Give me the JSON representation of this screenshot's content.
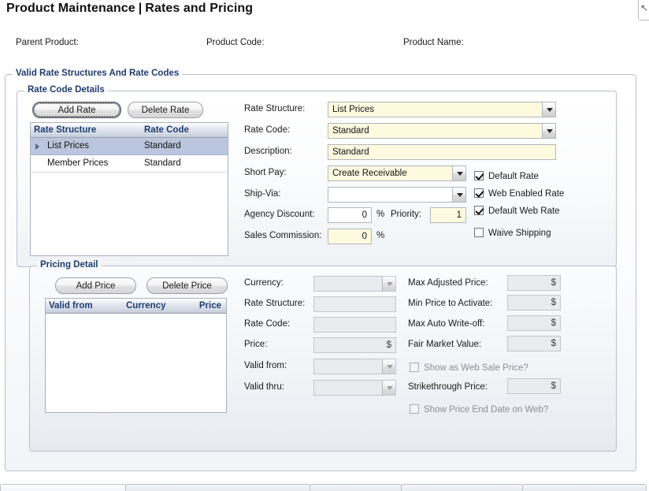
{
  "page": {
    "title_main": "Product Maintenance",
    "title_sep": "|",
    "title_sub": "Rates and Pricing"
  },
  "header_fields": [
    {
      "label": "Parent Product:",
      "value": ""
    },
    {
      "label": "Product Code:",
      "value": ""
    },
    {
      "label": "Product Name:",
      "value": ""
    }
  ],
  "outer_group": {
    "title": "Valid Rate Structures And Rate Codes"
  },
  "rate_code_details": {
    "title": "Rate Code Details",
    "buttons": {
      "add": "Add Rate",
      "delete": "Delete Rate"
    },
    "grid": {
      "columns": [
        "Rate Structure",
        "Rate Code"
      ],
      "rows": [
        {
          "rate_structure": "List Prices",
          "rate_code": "Standard",
          "selected": true
        },
        {
          "rate_structure": "Member Prices",
          "rate_code": "Standard",
          "selected": false
        }
      ]
    },
    "fields": {
      "rate_structure_label": "Rate Structure:",
      "rate_structure_value": "List Prices",
      "rate_code_label": "Rate Code:",
      "rate_code_value": "Standard",
      "description_label": "Description:",
      "description_value": "Standard",
      "short_pay_label": "Short Pay:",
      "short_pay_value": "Create Receivable",
      "ship_via_label": "Ship-Via:",
      "ship_via_value": "",
      "agency_discount_label": "Agency Discount:",
      "agency_discount_value": "0",
      "agency_discount_suffix": "%",
      "priority_label": "Priority:",
      "priority_value": "1",
      "sales_commission_label": "Sales Commission:",
      "sales_commission_value": "0",
      "sales_commission_suffix": "%"
    },
    "checkboxes": [
      {
        "label": "Default Rate",
        "checked": true,
        "enabled": true
      },
      {
        "label": "Web Enabled Rate",
        "checked": true,
        "enabled": true
      },
      {
        "label": "Default Web Rate",
        "checked": true,
        "enabled": true
      },
      {
        "label": "Waive Shipping",
        "checked": false,
        "enabled": true
      }
    ]
  },
  "pricing_detail": {
    "title": "Pricing Detail",
    "buttons": {
      "add": "Add Price",
      "delete": "Delete Price"
    },
    "grid": {
      "columns": [
        "Valid from",
        "Currency",
        "Price"
      ],
      "rows": []
    },
    "fields_left": {
      "currency_label": "Currency:",
      "currency_value": "",
      "rate_structure_label": "Rate Structure:",
      "rate_structure_value": "",
      "rate_code_label": "Rate Code:",
      "rate_code_value": "",
      "price_label": "Price:",
      "price_value": "",
      "price_suffix": "$",
      "valid_from_label": "Valid from:",
      "valid_from_value": "",
      "valid_thru_label": "Valid thru:",
      "valid_thru_value": ""
    },
    "fields_right": {
      "max_adjusted_price_label": "Max Adjusted Price:",
      "max_adjusted_price_value": "",
      "min_price_to_activate_label": "Min Price to Activate:",
      "min_price_to_activate_value": "",
      "max_auto_writeoff_label": "Max Auto Write-off:",
      "max_auto_writeoff_value": "",
      "fair_market_value_label": "Fair Market Value:",
      "fair_market_value_value": "",
      "strikethrough_price_label": "Strikethrough Price:",
      "strikethrough_price_value": "",
      "dollar_suffix": "$"
    },
    "checkboxes": [
      {
        "label": "Show as Web Sale Price?",
        "checked": false,
        "enabled": false
      },
      {
        "label": "Show Price End Date on Web?",
        "checked": false,
        "enabled": false
      }
    ]
  },
  "chrome": {
    "corner_icon": "mouse-pointer-icon",
    "corner_glyph": "↖"
  },
  "colors": {
    "accent_heading": "#1f3c70",
    "field_yellow": "#fdfae0",
    "field_disabled": "#e9ebee",
    "row_selected": "#b9c6dd",
    "panel_border": "#b9bfc9"
  }
}
